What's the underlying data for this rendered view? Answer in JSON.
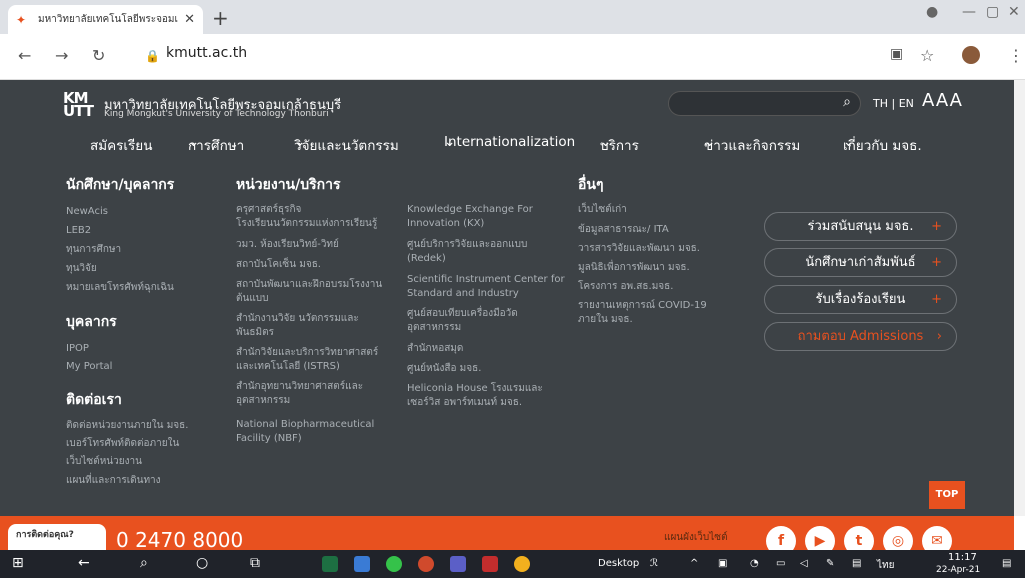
{
  "browser": {
    "tab_title": "มหาวิทยาลัยเทคโนโลยีพระจอมเกล้าธ",
    "url": "kmutt.ac.th"
  },
  "header": {
    "logo": "KMUTT",
    "name_th": "มหาวิทยาลัยเทคโนโลยีพระจอมเกล้าธนบุรี",
    "name_en": "King Mongkut's University of Technology Thonburi",
    "lang": "TH | EN",
    "aaa": "AAA"
  },
  "menu": [
    "สมัครเรียน",
    "การศึกษา",
    "วิจัยและนวัตกรรม",
    "Internationalization",
    "บริการ",
    "ข่าวและกิจกรรม",
    "เกี่ยวกับ มจธ."
  ],
  "col1": {
    "h1": "นักศึกษา/บุคลากร",
    "l1": [
      "NewAcis",
      "LEB2",
      "ทุนการศึกษา",
      "ทุนวิจัย",
      "หมายเลขโทรศัพท์ฉุกเฉิน"
    ],
    "h2": "บุคลากร",
    "l2": [
      "IPOP",
      "My Portal"
    ],
    "h3": "ติดต่อเรา",
    "l3": [
      "ติดต่อหน่วยงานภายใน มจธ.",
      "เบอร์โทรศัพท์ติดต่อภายใน",
      "เว็บไซต์หน่วยงาน",
      "แผนที่และการเดินทาง"
    ]
  },
  "col2": {
    "h": "หน่วยงาน/บริการ",
    "l": [
      "ครุศาสตร์ธุรกิจ",
      "โรงเรียนนวัตกรรมแห่งการเรียนรู้",
      "วมว. ห้องเรียนวิทย์-วิทย์",
      "สถาบันโคเซ็น มจธ.",
      "สถาบันพัฒนาและฝึกอบรมโรงงาน",
      "ต้นแบบ",
      "สำนักงานวิจัย นวัตกรรมและ",
      "พันธมิตร",
      "สำนักวิจัยและบริการวิทยาศาสตร์",
      "และเทคโนโลยี (ISTRS)",
      "สำนักอุทยานวิทยาศาสตร์และ",
      "อุตสาหกรรม",
      "National Biopharmaceutical",
      "Facility (NBF)"
    ]
  },
  "col3": {
    "l": [
      "Knowledge Exchange For",
      "Innovation (KX)",
      "ศูนย์บริการวิจัยและออกแบบ",
      "(Redek)",
      "Scientific Instrument Center for",
      "Standard and Industry",
      "ศูนย์สอบเทียบเครื่องมือวัด",
      "อุตสาหกรรม",
      "สำนักหอสมุด",
      "ศูนย์หนังสือ มจธ.",
      "Heliconia House โรงแรมและ",
      "เซอร์วิส อพาร์ทเมนท์ มจธ."
    ]
  },
  "col4": {
    "h": "อื่นๆ",
    "l": [
      "เว็บไซต์เก่า",
      "ข้อมูลสาธารณะ/ ITA",
      "วารสารวิจัยและพัฒนา มจธ.",
      "มูลนิธิเพื่อการพัฒนา มจธ.",
      "โครงการ อพ.สธ.มจธ.",
      "รายงานเหตุการณ์ COVID-19",
      "ภายใน มจธ."
    ]
  },
  "cta": [
    "ร่วมสนับสนุน มจธ.",
    "นักศึกษาเก่าสัมพันธ์",
    "รับเรื่องร้องเรียน",
    "ถามตอบ Admissions"
  ],
  "top": "TOP",
  "footer": {
    "call": "การติดต่อคุณ?",
    "phone": "0 2470 8000",
    "sitemap": "แผนผังเว็บไซต์"
  },
  "taskbar": {
    "desktop": "Desktop",
    "time": "11:17",
    "date": "22-Apr-21",
    "lang": "ไทย"
  }
}
